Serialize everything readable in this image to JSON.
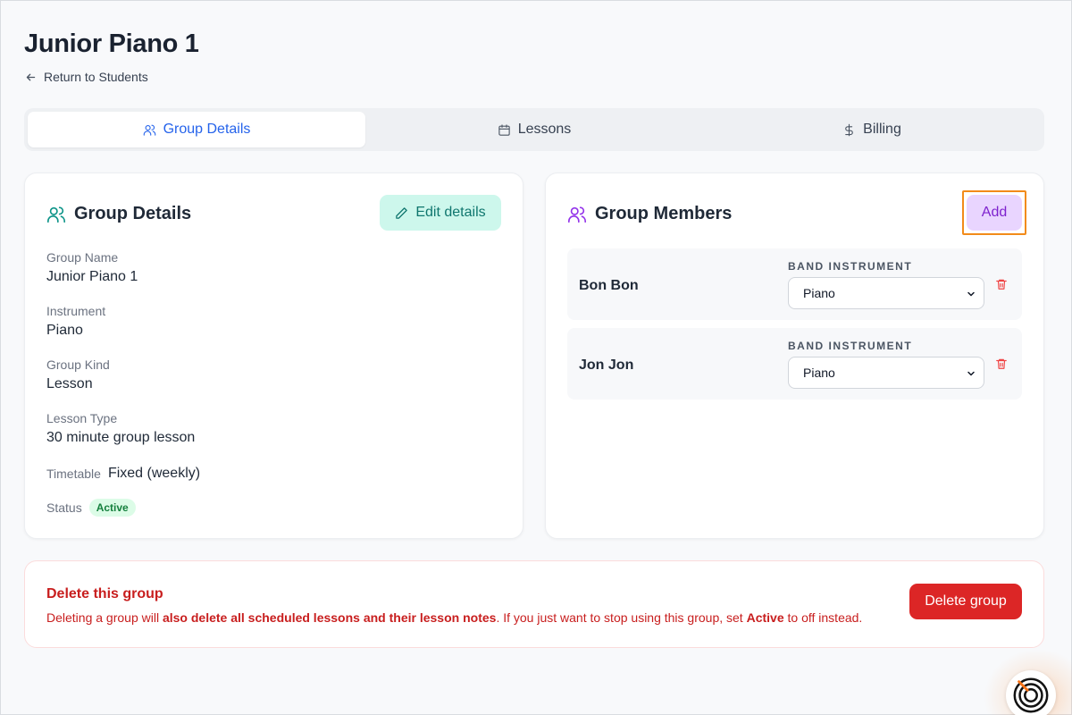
{
  "header": {
    "title": "Junior Piano 1",
    "back_label": "Return to Students"
  },
  "tabs": [
    {
      "label": "Group Details",
      "icon": "users-icon",
      "active": true
    },
    {
      "label": "Lessons",
      "icon": "calendar-icon",
      "active": false
    },
    {
      "label": "Billing",
      "icon": "dollar-icon",
      "active": false
    }
  ],
  "details": {
    "title": "Group Details",
    "edit_label": "Edit details",
    "fields": [
      {
        "label": "Group Name",
        "value": "Junior Piano 1"
      },
      {
        "label": "Instrument",
        "value": "Piano"
      },
      {
        "label": "Group Kind",
        "value": "Lesson"
      },
      {
        "label": "Lesson Type",
        "value": "30 minute group lesson"
      },
      {
        "label": "Timetable",
        "value": "Fixed (weekly)"
      },
      {
        "label": "Status",
        "value": "Active"
      }
    ]
  },
  "members": {
    "title": "Group Members",
    "add_label": "Add",
    "instrument_label": "BAND INSTRUMENT",
    "items": [
      {
        "name": "Bon Bon",
        "instrument": "Piano"
      },
      {
        "name": "Jon Jon",
        "instrument": "Piano"
      }
    ]
  },
  "danger": {
    "title": "Delete this group",
    "text_1": "Deleting a group will ",
    "text_bold_1": "also delete all scheduled lessons and their lesson notes",
    "text_2": ". If you just want to stop using this group, set ",
    "text_bold_2": "Active",
    "text_3": " to off instead.",
    "button_label": "Delete group"
  },
  "colors": {
    "accent_blue": "#2563eb",
    "teal": "#0f766e",
    "purple": "#7e22ce",
    "danger": "#dc2626",
    "highlight_outline": "#f28b1a"
  }
}
